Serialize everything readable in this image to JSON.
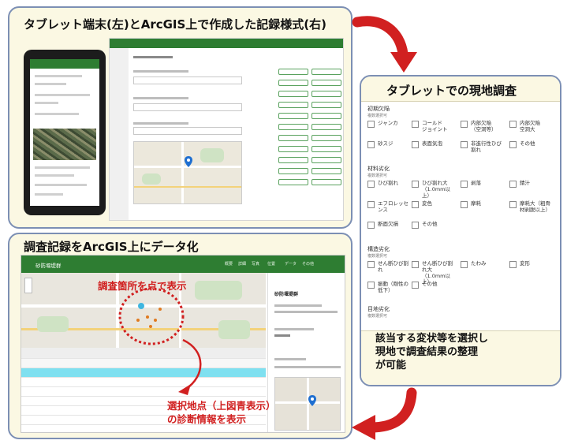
{
  "panels": {
    "top_left_title": "タブレット端末(左)とArcGIS上で作成した記録様式(右)",
    "right_title": "タブレットでの現地調査",
    "bottom_left_title": "調査記録をArcGIS上にデータ化"
  },
  "survey_form": {
    "sections": [
      {
        "label": "初期欠陥",
        "sub": "複数選択可",
        "options": [
          [
            "ジャンカ",
            "コールド\nジョイント",
            "内部欠陥\n（空洞等）",
            "内部欠陥\n空洞大"
          ],
          [
            "砂スジ",
            "表面気泡",
            "非進行性ひび割れ",
            "その他"
          ]
        ]
      },
      {
        "label": "材料劣化",
        "sub": "複数選択可",
        "options": [
          [
            "ひび割れ",
            "ひび割れ大\n（1.0mm以上）",
            "剥落",
            "錆汁"
          ],
          [
            "エフロレッセンス",
            "変色",
            "摩耗",
            "摩耗大（粗骨材剥脱以上）"
          ],
          [
            "断面欠損",
            "その他"
          ]
        ]
      },
      {
        "label": "構造劣化",
        "sub": "複数選択可",
        "options": [
          [
            "せん断ひび割れ",
            "せん断ひび割れ大\n（1.0mm以上）",
            "たわみ",
            "変形"
          ],
          [
            "振動（剛性の低下）",
            "その他"
          ]
        ]
      },
      {
        "label": "目地劣化",
        "sub": "複数選択可",
        "options": []
      }
    ]
  },
  "right_footer": "該当する変状等を選択し\n現地で調査結果の整理\nが可能",
  "arcgis_app": {
    "app_name": "砂防堰堤群",
    "tabs": [
      "概要",
      "詳細",
      "写真",
      "位置",
      "データ",
      "その他"
    ],
    "side_title": "砂防堰堤群"
  },
  "callouts": {
    "points": "調査箇所を点で表示",
    "selected": "選択地点（上図青表示）\nの診断情報を表示"
  },
  "colors": {
    "accent_red": "#d12020",
    "header_green": "#2e7d32",
    "panel_border": "#7c8fb4",
    "panel_bg": "#fbf8e3",
    "highlight_row": "#7fe0f0"
  }
}
